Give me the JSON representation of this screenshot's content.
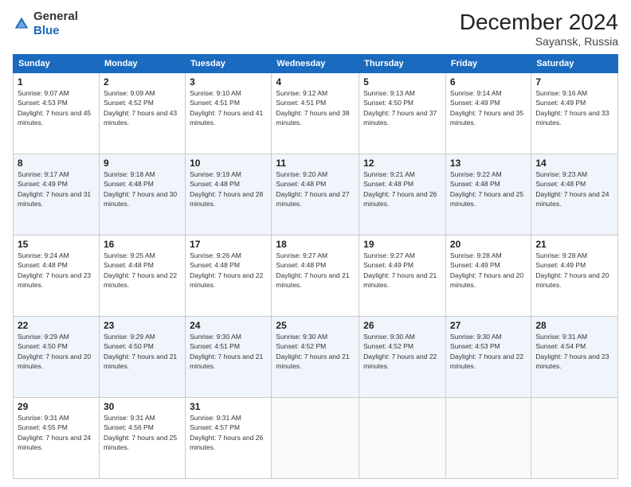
{
  "logo": {
    "text_general": "General",
    "text_blue": "Blue"
  },
  "header": {
    "month": "December 2024",
    "location": "Sayansk, Russia"
  },
  "weekdays": [
    "Sunday",
    "Monday",
    "Tuesday",
    "Wednesday",
    "Thursday",
    "Friday",
    "Saturday"
  ],
  "weeks": [
    [
      {
        "day": "1",
        "sunrise": "9:07 AM",
        "sunset": "4:53 PM",
        "daylight": "7 hours and 45 minutes."
      },
      {
        "day": "2",
        "sunrise": "9:09 AM",
        "sunset": "4:52 PM",
        "daylight": "7 hours and 43 minutes."
      },
      {
        "day": "3",
        "sunrise": "9:10 AM",
        "sunset": "4:51 PM",
        "daylight": "7 hours and 41 minutes."
      },
      {
        "day": "4",
        "sunrise": "9:12 AM",
        "sunset": "4:51 PM",
        "daylight": "7 hours and 38 minutes."
      },
      {
        "day": "5",
        "sunrise": "9:13 AM",
        "sunset": "4:50 PM",
        "daylight": "7 hours and 37 minutes."
      },
      {
        "day": "6",
        "sunrise": "9:14 AM",
        "sunset": "4:49 PM",
        "daylight": "7 hours and 35 minutes."
      },
      {
        "day": "7",
        "sunrise": "9:16 AM",
        "sunset": "4:49 PM",
        "daylight": "7 hours and 33 minutes."
      }
    ],
    [
      {
        "day": "8",
        "sunrise": "9:17 AM",
        "sunset": "4:49 PM",
        "daylight": "7 hours and 31 minutes."
      },
      {
        "day": "9",
        "sunrise": "9:18 AM",
        "sunset": "4:48 PM",
        "daylight": "7 hours and 30 minutes."
      },
      {
        "day": "10",
        "sunrise": "9:19 AM",
        "sunset": "4:48 PM",
        "daylight": "7 hours and 28 minutes."
      },
      {
        "day": "11",
        "sunrise": "9:20 AM",
        "sunset": "4:48 PM",
        "daylight": "7 hours and 27 minutes."
      },
      {
        "day": "12",
        "sunrise": "9:21 AM",
        "sunset": "4:48 PM",
        "daylight": "7 hours and 26 minutes."
      },
      {
        "day": "13",
        "sunrise": "9:22 AM",
        "sunset": "4:48 PM",
        "daylight": "7 hours and 25 minutes."
      },
      {
        "day": "14",
        "sunrise": "9:23 AM",
        "sunset": "4:48 PM",
        "daylight": "7 hours and 24 minutes."
      }
    ],
    [
      {
        "day": "15",
        "sunrise": "9:24 AM",
        "sunset": "4:48 PM",
        "daylight": "7 hours and 23 minutes."
      },
      {
        "day": "16",
        "sunrise": "9:25 AM",
        "sunset": "4:48 PM",
        "daylight": "7 hours and 22 minutes."
      },
      {
        "day": "17",
        "sunrise": "9:26 AM",
        "sunset": "4:48 PM",
        "daylight": "7 hours and 22 minutes."
      },
      {
        "day": "18",
        "sunrise": "9:27 AM",
        "sunset": "4:48 PM",
        "daylight": "7 hours and 21 minutes."
      },
      {
        "day": "19",
        "sunrise": "9:27 AM",
        "sunset": "4:49 PM",
        "daylight": "7 hours and 21 minutes."
      },
      {
        "day": "20",
        "sunrise": "9:28 AM",
        "sunset": "4:49 PM",
        "daylight": "7 hours and 20 minutes."
      },
      {
        "day": "21",
        "sunrise": "9:28 AM",
        "sunset": "4:49 PM",
        "daylight": "7 hours and 20 minutes."
      }
    ],
    [
      {
        "day": "22",
        "sunrise": "9:29 AM",
        "sunset": "4:50 PM",
        "daylight": "7 hours and 20 minutes."
      },
      {
        "day": "23",
        "sunrise": "9:29 AM",
        "sunset": "4:50 PM",
        "daylight": "7 hours and 21 minutes."
      },
      {
        "day": "24",
        "sunrise": "9:30 AM",
        "sunset": "4:51 PM",
        "daylight": "7 hours and 21 minutes."
      },
      {
        "day": "25",
        "sunrise": "9:30 AM",
        "sunset": "4:52 PM",
        "daylight": "7 hours and 21 minutes."
      },
      {
        "day": "26",
        "sunrise": "9:30 AM",
        "sunset": "4:52 PM",
        "daylight": "7 hours and 22 minutes."
      },
      {
        "day": "27",
        "sunrise": "9:30 AM",
        "sunset": "4:53 PM",
        "daylight": "7 hours and 22 minutes."
      },
      {
        "day": "28",
        "sunrise": "9:31 AM",
        "sunset": "4:54 PM",
        "daylight": "7 hours and 23 minutes."
      }
    ],
    [
      {
        "day": "29",
        "sunrise": "9:31 AM",
        "sunset": "4:55 PM",
        "daylight": "7 hours and 24 minutes."
      },
      {
        "day": "30",
        "sunrise": "9:31 AM",
        "sunset": "4:56 PM",
        "daylight": "7 hours and 25 minutes."
      },
      {
        "day": "31",
        "sunrise": "9:31 AM",
        "sunset": "4:57 PM",
        "daylight": "7 hours and 26 minutes."
      },
      null,
      null,
      null,
      null
    ]
  ]
}
